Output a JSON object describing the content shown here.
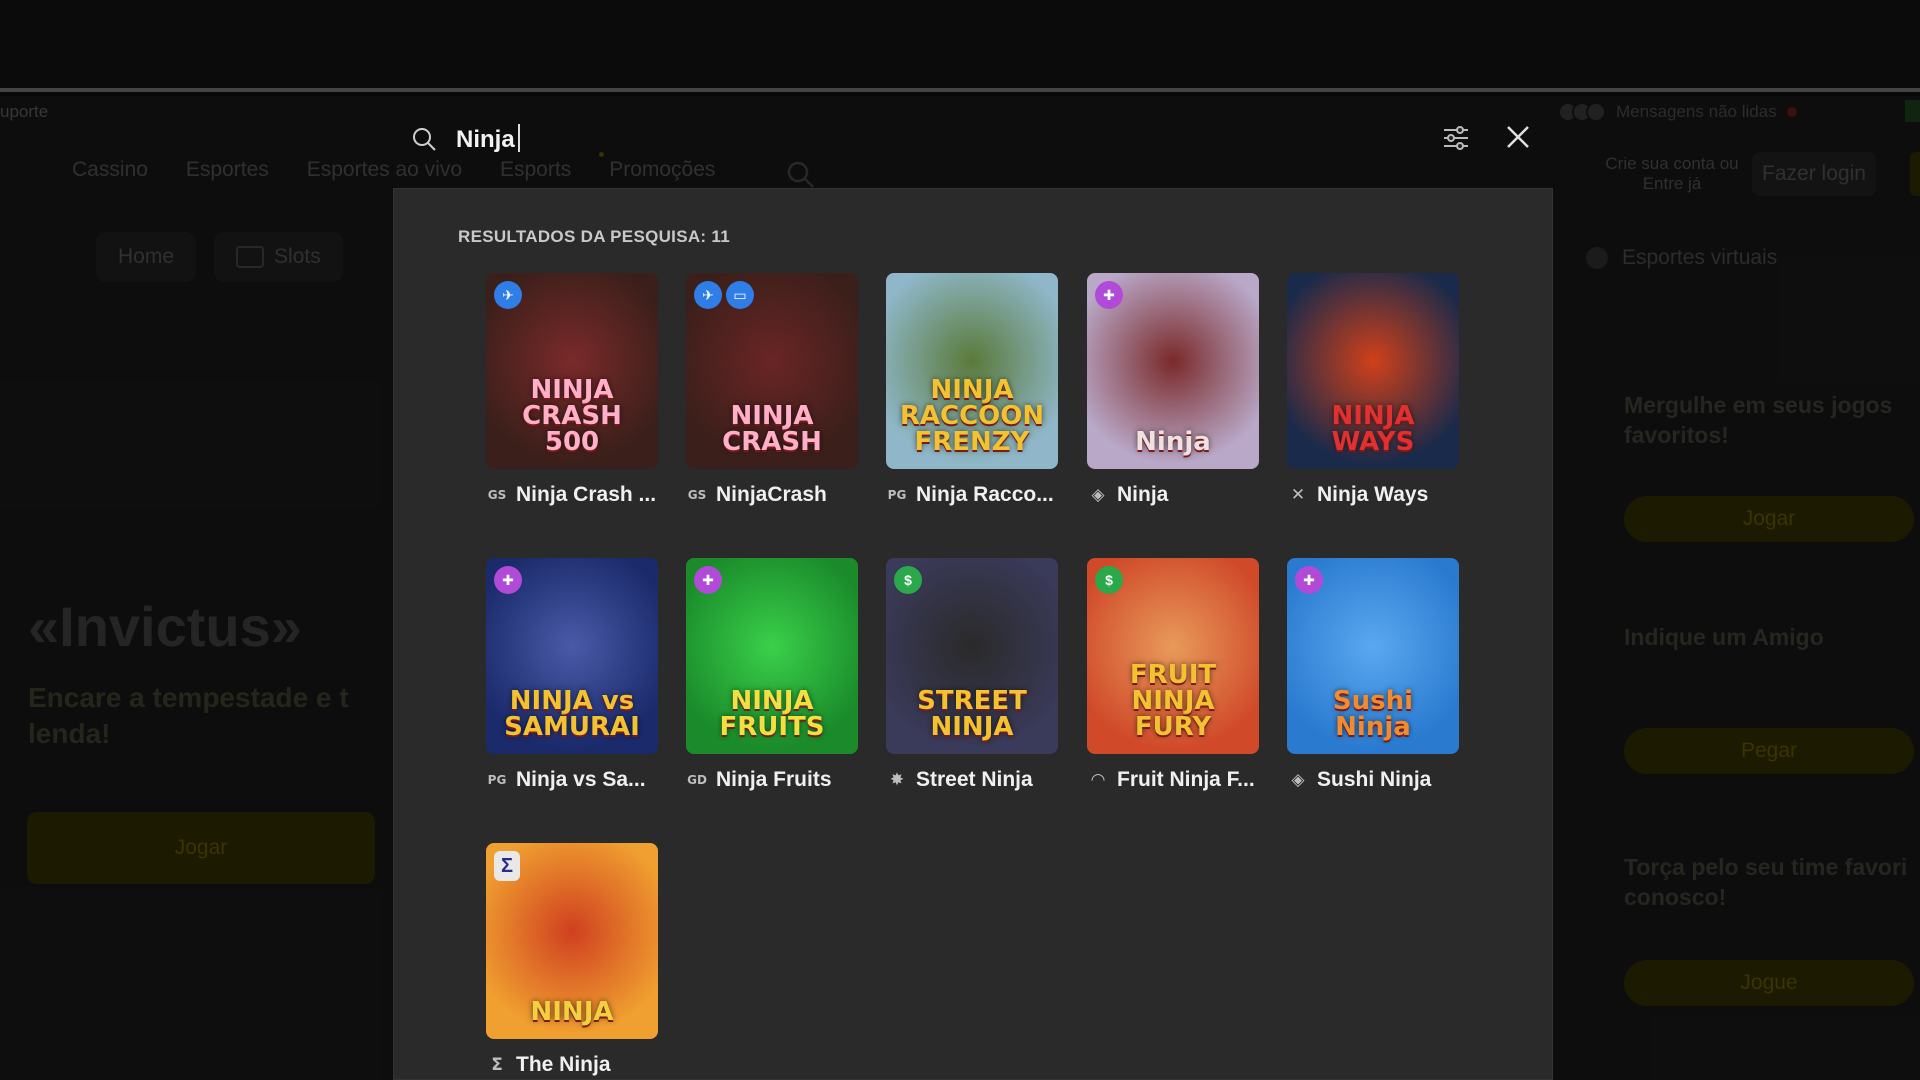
{
  "background": {
    "support_text": "uporte",
    "nav": [
      "Cassino",
      "Esportes",
      "Esportes ao vivo",
      "Esports",
      "Promoções"
    ],
    "chips": [
      "Home",
      "Slots"
    ],
    "hero_title": "«Invictus»",
    "hero_subtitle": "Encare a tempestade e t lenda!",
    "hero_button": "Jogar",
    "messages_text": "Mensagens não lidas",
    "create_account": "Crie sua conta ou Entre já",
    "login_button": "Fazer login",
    "virtual_sports": "Esportes virtuais",
    "promos": [
      {
        "title": "Mergulhe em seus jogos favoritos!",
        "button": "Jogar"
      },
      {
        "title": "Indique um Amigo",
        "button": "Pegar"
      },
      {
        "title": "Torça pelo seu time favori conosco!",
        "button": "Jogue"
      }
    ]
  },
  "search": {
    "query": "Ninja",
    "results_label": "RESULTADOS DA PESQUISA: 11"
  },
  "games": [
    {
      "name": "Ninja Crash ...",
      "provider": "GS",
      "art": "NINJA CRASH 500",
      "badges": [
        "plane-badge-icon"
      ],
      "badge_colors": [
        "blue"
      ],
      "bg": "#3a1f1a",
      "bg2": "#7a2a2a",
      "title_color": "#ffb0c8"
    },
    {
      "name": "NinjaCrash",
      "provider": "GS",
      "art": "NINJA CRASH",
      "badges": [
        "plane-badge-icon",
        "monitor-badge-icon"
      ],
      "badge_colors": [
        "blue",
        "blue"
      ],
      "bg": "#3a1f1a",
      "bg2": "#6a2525",
      "title_color": "#ffb0c8"
    },
    {
      "name": "Ninja Racco...",
      "provider": "PG",
      "art": "NINJA RACCOON FRENZY",
      "badges": [],
      "badge_colors": [],
      "bg": "#8fb7c9",
      "bg2": "#5a7a3a",
      "title_color": "#f2c230"
    },
    {
      "name": "Ninja",
      "provider": "◈",
      "art": "Ninja",
      "badges": [
        "gift-badge-icon"
      ],
      "badge_colors": [
        "purple"
      ],
      "bg": "#b9a8c8",
      "bg2": "#7a2a2a",
      "title_color": "#f0e0e0"
    },
    {
      "name": "Ninja Ways",
      "provider": "✕",
      "art": "NINJA WAYS",
      "badges": [],
      "badge_colors": [],
      "bg": "#1a2a4a",
      "bg2": "#d0401a",
      "title_color": "#e03030"
    },
    {
      "name": "Ninja vs Sa...",
      "provider": "PG",
      "art": "NINJA vs SAMURAI",
      "badges": [
        "gift-badge-icon"
      ],
      "badge_colors": [
        "purple"
      ],
      "bg": "#1a2a6a",
      "bg2": "#4a5aa8",
      "title_color": "#f2c230"
    },
    {
      "name": "Ninja Fruits",
      "provider": "GD",
      "art": "NINJA FRUITS",
      "badges": [
        "gift-badge-icon"
      ],
      "badge_colors": [
        "purple"
      ],
      "bg": "#1a8a2a",
      "bg2": "#3ad04a",
      "title_color": "#f2e040"
    },
    {
      "name": "Street Ninja",
      "provider": "✸",
      "art": "STREET NINJA",
      "badges": [
        "cash-badge-icon"
      ],
      "badge_colors": [
        "green"
      ],
      "bg": "#3a3a5a",
      "bg2": "#2a2a2a",
      "title_color": "#f2c230"
    },
    {
      "name": "Fruit Ninja F...",
      "provider": "◠",
      "art": "FRUIT NINJA FURY",
      "badges": [
        "cash-badge-icon"
      ],
      "badge_colors": [
        "green"
      ],
      "bg": "#d04a2a",
      "bg2": "#e89a5a",
      "title_color": "#f2c230"
    },
    {
      "name": "Sushi Ninja",
      "provider": "◈",
      "art": "Sushi Ninja",
      "badges": [
        "gift-badge-icon"
      ],
      "badge_colors": [
        "purple"
      ],
      "bg": "#2a7ad0",
      "bg2": "#5aa8f0",
      "title_color": "#f28a30"
    },
    {
      "name": "The Ninja",
      "provider": "Σ",
      "art": "NINJA",
      "badges": [
        "sigma-badge-icon"
      ],
      "badge_colors": [
        "sig"
      ],
      "bg": "#f0a030",
      "bg2": "#d04020",
      "title_color": "#f2d040"
    }
  ]
}
